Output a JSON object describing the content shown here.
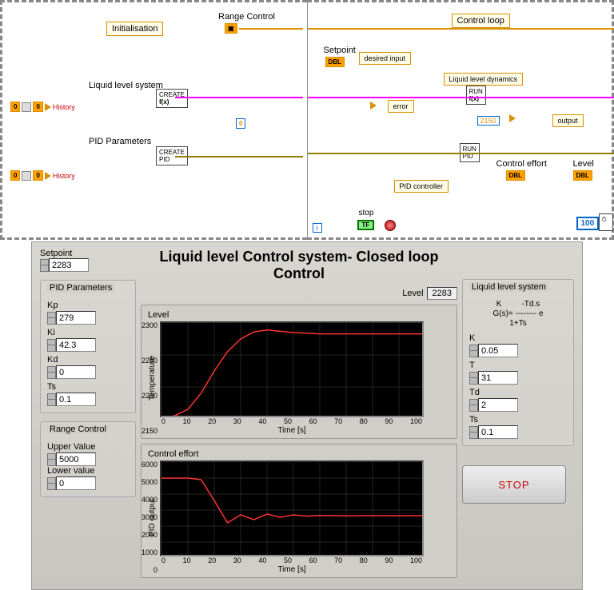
{
  "block_diagram": {
    "left_title": "Initialisation",
    "right_title": "Control loop",
    "range_control": "Range Control",
    "liquid_level_system": "Liquid level system",
    "pid_parameters": "PID Parameters",
    "history1": "History",
    "history2": "History",
    "setpoint_label": "Setpoint",
    "desired_input": "desired input",
    "error": "error",
    "liquid_level_dynamics": "Liquid level dynamics",
    "output": "output",
    "pid_controller": "PID controller",
    "control_effort": "Control effort",
    "level": "Level",
    "stop": "stop",
    "const_zero": "0",
    "const_2150": "2150",
    "const_100": "100",
    "zero_a": "0",
    "zero_b": "0",
    "zero_c": "0",
    "zero_d": "0",
    "terminals": {
      "dbl": "DBL",
      "tf": "TF",
      "create": "CREATE",
      "run": "RUN",
      "fx": "f(x)",
      "pid": "PID"
    }
  },
  "front_panel": {
    "title": "Liquid level Control system- Closed loop Control",
    "setpoint_label": "Setpoint",
    "setpoint": "2283",
    "level_label": "Level",
    "level": "2283",
    "pid_group": "PID Parameters",
    "pid": {
      "Kp_label": "Kp",
      "Kp": "279",
      "Ki_label": "Ki",
      "Ki": "42.3",
      "Kd_label": "Kd",
      "Kd": "0",
      "Ts_label": "Ts",
      "Ts": "0.1"
    },
    "range_group": "Range Control",
    "range": {
      "upper_label": "Upper Value",
      "upper": "5000",
      "lower_label": "Lower value",
      "lower": "0"
    },
    "sys_group": "Liquid level system",
    "formula_line1": "K         -Td.s",
    "formula_line2": "G(s)= -------- e",
    "formula_line3": "1+Ts",
    "sys": {
      "K_label": "K",
      "K": "0.05",
      "T_label": "T",
      "T": "31",
      "Td_label": "Td",
      "Td": "2",
      "Ts_label": "Ts",
      "Ts": "0.1"
    },
    "level_chart_title": "Level",
    "effort_chart_title": "Control effort",
    "xlabel": "Time [s]",
    "y1label": "Temperature",
    "y2label": "PID output",
    "stop": "STOP"
  },
  "chart_data": [
    {
      "type": "line",
      "title": "Level",
      "xlabel": "Time [s]",
      "ylabel": "Temperature",
      "xlim": [
        0,
        100
      ],
      "ylim": [
        2150,
        2300
      ],
      "x": [
        0,
        5,
        10,
        15,
        20,
        25,
        30,
        35,
        40,
        45,
        50,
        60,
        70,
        80,
        90,
        100
      ],
      "values": [
        2150,
        2155,
        2165,
        2190,
        2225,
        2255,
        2275,
        2286,
        2289,
        2287,
        2285,
        2283,
        2283,
        2283,
        2283,
        2283
      ]
    },
    {
      "type": "line",
      "title": "Control effort",
      "xlabel": "Time [s]",
      "ylabel": "PID output",
      "xlim": [
        0,
        100
      ],
      "ylim": [
        0,
        6000
      ],
      "x": [
        0,
        5,
        10,
        15,
        20,
        25,
        30,
        35,
        40,
        45,
        50,
        55,
        60,
        70,
        80,
        90,
        100
      ],
      "values": [
        5000,
        5000,
        5000,
        4900,
        3600,
        2200,
        2700,
        2400,
        2750,
        2550,
        2700,
        2620,
        2660,
        2640,
        2650,
        2645,
        2650
      ]
    }
  ]
}
